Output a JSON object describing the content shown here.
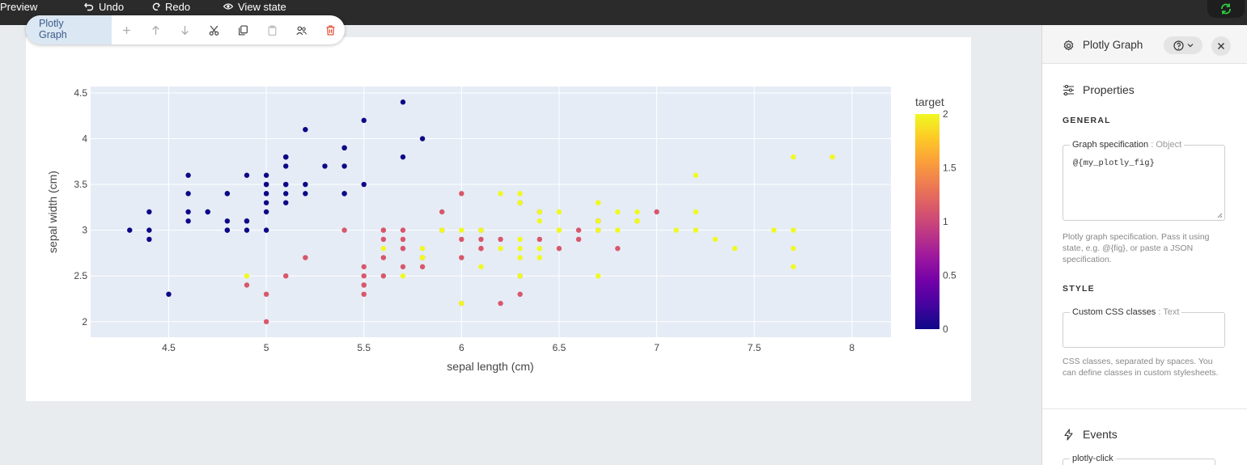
{
  "topbar": {
    "preview_label": "Preview",
    "undo_label": "Undo",
    "redo_label": "Redo",
    "view_state_label": "View state"
  },
  "component_toolbar": {
    "name_line1": "Plotly",
    "name_line2": "Graph",
    "buttons": [
      "add-icon",
      "move-up-icon",
      "move-down-icon",
      "cut-icon",
      "copy-icon",
      "paste-icon",
      "users-icon",
      "delete-icon"
    ],
    "delete_color": "#e2432b"
  },
  "panel": {
    "title": "Plotly Graph",
    "properties_label": "Properties",
    "general_label": "GENERAL",
    "graph_spec_label": "Graph specification",
    "graph_spec_type": ": Object",
    "graph_spec_value": "@{my_plotly_fig}",
    "graph_spec_help": "Plotly graph specification. Pass it using state, e.g. @{fig}, or paste a JSON specification.",
    "style_label": "STYLE",
    "css_label": "Custom CSS classes",
    "css_type": ": Text",
    "css_value": "",
    "css_help": "CSS classes, separated by spaces. You can define classes in custom stylesheets.",
    "events_label": "Events",
    "plotly_click_label": "plotly-click"
  },
  "chart_data": {
    "type": "scatter",
    "xlabel": "sepal length (cm)",
    "ylabel": "sepal width (cm)",
    "xlim": [
      4.1,
      8.2
    ],
    "ylim": [
      1.83,
      4.57
    ],
    "xticks": [
      "4.5",
      "5",
      "5.5",
      "6",
      "6.5",
      "7",
      "7.5",
      "8"
    ],
    "yticks": [
      "2",
      "2.5",
      "3",
      "3.5",
      "4",
      "4.5"
    ],
    "grid": true,
    "plot_bgcolor": "#e5ecf6",
    "colorbar": {
      "title": "target",
      "ticks": [
        "0",
        "0.5",
        "1",
        "1.5",
        "2"
      ],
      "range": [
        0,
        2
      ],
      "colorscale": [
        "#0d0887",
        "#46039f",
        "#7201a8",
        "#9c179e",
        "#bd3786",
        "#d8576b",
        "#ed7953",
        "#fb9f3a",
        "#fdca26",
        "#f0f921"
      ]
    },
    "series": [
      {
        "target": 0,
        "x": [
          5.1,
          4.9,
          4.7,
          4.6,
          5.0,
          5.4,
          4.6,
          5.0,
          4.4,
          4.9,
          5.4,
          4.8,
          4.8,
          4.3,
          5.8,
          5.7,
          5.4,
          5.1,
          5.7,
          5.1,
          5.4,
          5.1,
          4.6,
          5.1,
          4.8,
          5.0,
          5.0,
          5.2,
          5.2,
          4.7,
          4.8,
          5.4,
          5.2,
          5.5,
          4.9,
          5.0,
          5.5,
          4.9,
          4.4,
          5.1,
          5.0,
          4.5,
          4.4,
          5.0,
          5.1,
          4.8,
          5.1,
          4.6,
          5.3,
          5.0
        ],
        "y": [
          3.5,
          3.0,
          3.2,
          3.1,
          3.6,
          3.9,
          3.4,
          3.4,
          2.9,
          3.1,
          3.7,
          3.4,
          3.0,
          3.0,
          4.0,
          4.4,
          3.9,
          3.5,
          3.8,
          3.8,
          3.4,
          3.7,
          3.6,
          3.3,
          3.4,
          3.0,
          3.4,
          3.5,
          3.4,
          3.2,
          3.1,
          3.4,
          4.1,
          4.2,
          3.1,
          3.2,
          3.5,
          3.6,
          3.0,
          3.4,
          3.5,
          2.3,
          3.2,
          3.5,
          3.8,
          3.0,
          3.8,
          3.2,
          3.7,
          3.3
        ]
      },
      {
        "target": 1,
        "x": [
          7.0,
          6.4,
          6.9,
          5.5,
          6.5,
          5.7,
          6.3,
          4.9,
          6.6,
          5.2,
          5.0,
          5.9,
          6.0,
          6.1,
          5.6,
          6.7,
          5.6,
          5.8,
          6.2,
          5.6,
          5.9,
          6.1,
          6.3,
          6.1,
          6.4,
          6.6,
          6.8,
          6.7,
          6.0,
          5.7,
          5.5,
          5.5,
          5.8,
          6.0,
          5.4,
          6.0,
          6.7,
          6.3,
          5.6,
          5.5,
          5.5,
          6.1,
          5.8,
          5.0,
          5.6,
          5.7,
          5.7,
          6.2,
          5.1,
          5.7
        ],
        "y": [
          3.2,
          3.2,
          3.1,
          2.3,
          2.8,
          2.8,
          3.3,
          2.4,
          2.9,
          2.7,
          2.0,
          3.0,
          2.2,
          2.9,
          2.9,
          3.1,
          3.0,
          2.7,
          2.2,
          2.5,
          3.2,
          2.8,
          2.5,
          2.8,
          2.9,
          3.0,
          2.8,
          3.0,
          2.9,
          2.6,
          2.4,
          2.4,
          2.7,
          2.7,
          3.0,
          3.4,
          3.1,
          2.3,
          3.0,
          2.5,
          2.6,
          3.0,
          2.6,
          2.3,
          2.7,
          3.0,
          2.9,
          2.9,
          2.5,
          2.8
        ]
      },
      {
        "target": 2,
        "x": [
          6.3,
          5.8,
          7.1,
          6.3,
          6.5,
          7.6,
          4.9,
          7.3,
          6.7,
          7.2,
          6.5,
          6.4,
          6.8,
          5.7,
          5.8,
          6.4,
          6.5,
          7.7,
          7.7,
          6.0,
          6.9,
          5.6,
          7.7,
          6.3,
          6.7,
          7.2,
          6.2,
          6.1,
          6.4,
          7.2,
          7.4,
          7.9,
          6.4,
          6.3,
          6.1,
          7.7,
          6.3,
          6.4,
          6.0,
          6.9,
          6.7,
          6.9,
          5.8,
          6.8,
          6.7,
          6.7,
          6.3,
          6.5,
          6.2,
          5.9
        ],
        "y": [
          3.3,
          2.7,
          3.0,
          2.9,
          3.0,
          3.0,
          2.5,
          2.9,
          2.5,
          3.6,
          3.2,
          2.7,
          3.0,
          2.5,
          2.8,
          3.2,
          3.0,
          3.8,
          2.6,
          2.2,
          3.2,
          2.8,
          2.8,
          2.7,
          3.3,
          3.2,
          2.8,
          3.0,
          2.8,
          3.0,
          2.8,
          3.8,
          2.8,
          2.8,
          2.6,
          3.0,
          3.4,
          3.1,
          3.0,
          3.1,
          3.1,
          3.1,
          2.7,
          3.2,
          3.3,
          3.0,
          2.5,
          3.0,
          3.4,
          3.0
        ]
      }
    ]
  }
}
